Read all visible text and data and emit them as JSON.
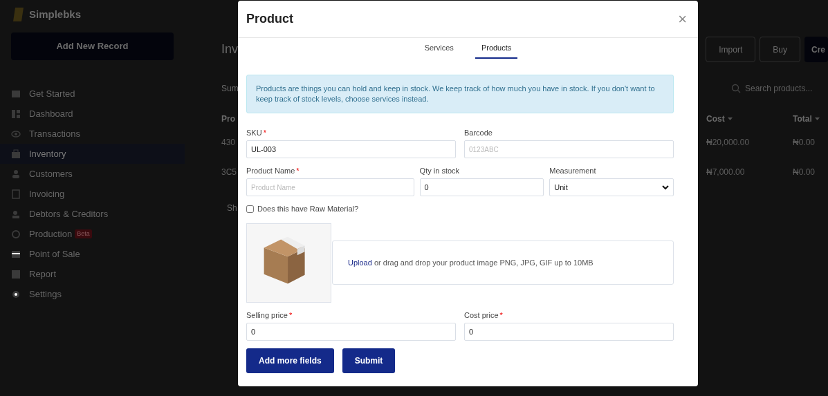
{
  "app": {
    "logo": "Simplebks",
    "add_button": "Add New Record",
    "nav": [
      {
        "label": "Get Started",
        "selected": false
      },
      {
        "label": "Dashboard",
        "selected": false
      },
      {
        "label": "Transactions",
        "selected": false
      },
      {
        "label": "Inventory",
        "selected": true
      },
      {
        "label": "Customers",
        "selected": false
      },
      {
        "label": "Invoicing",
        "selected": false
      },
      {
        "label": "Debtors & Creditors",
        "selected": false
      },
      {
        "label": "Production",
        "selected": false,
        "badge": "Beta"
      },
      {
        "label": "Point of Sale",
        "selected": false
      },
      {
        "label": "Report",
        "selected": false
      },
      {
        "label": "Settings",
        "selected": false
      }
    ],
    "page_title": "Inv",
    "header_buttons": [
      {
        "label": "Import",
        "primary": false
      },
      {
        "label": "Buy",
        "primary": false
      },
      {
        "label": "Cre",
        "primary": true
      }
    ],
    "summary": "Sum",
    "search": {
      "placeholder": "Search products..."
    },
    "table": {
      "columns": [
        {
          "label": "Pro"
        },
        {
          "label": "Cost",
          "sortable": true
        },
        {
          "label": "Total",
          "sortable": true
        }
      ],
      "rows": [
        [
          "430",
          "₦20,000.00",
          "₦0.00"
        ],
        [
          "3C5",
          "₦7,000.00",
          "₦0.00"
        ]
      ]
    },
    "footer_text": "Sh"
  },
  "modal": {
    "title": "Product",
    "close": "×",
    "tabs": [
      {
        "label": "Services",
        "selected": false
      },
      {
        "label": "Products",
        "selected": true
      }
    ],
    "info": "Products are things you can hold and keep in stock. We keep track of how much you have in stock. If you don't want to keep track of stock levels, choose services instead.",
    "field_rows": [
      [
        {
          "kind": "text",
          "label": "SKU",
          "required_mark": "*",
          "value": "UL-003"
        },
        {
          "kind": "text",
          "label": "Barcode",
          "placeholder": "0123ABC"
        }
      ],
      [
        {
          "kind": "text",
          "label": "Product Name",
          "required_mark": "*",
          "placeholder": "Product Name"
        },
        {
          "kind": "text",
          "label": "Qty in stock",
          "value": "0"
        },
        {
          "kind": "select",
          "label": "Measurement",
          "value": "Unit"
        }
      ]
    ],
    "checkbox": {
      "label": "Does this have Raw Material?",
      "checked": false
    },
    "upload": {
      "link": "Upload",
      "text": "or drag and drop your product image PNG, JPG, GIF up to 10MB"
    },
    "price_row": [
      {
        "kind": "text",
        "label": "Selling price",
        "required_mark": "*",
        "value": "0"
      },
      {
        "kind": "text",
        "label": "Cost price",
        "required_mark": "*",
        "value": "0"
      }
    ],
    "buttons": [
      "Add more fields",
      "Submit"
    ]
  }
}
